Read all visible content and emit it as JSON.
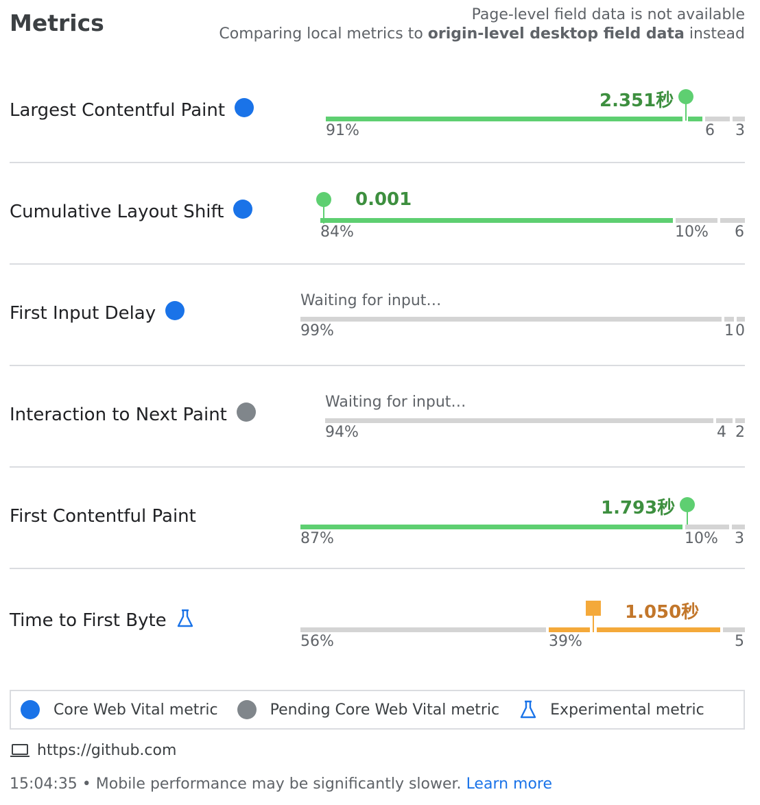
{
  "header": {
    "title": "Metrics",
    "note_line1": "Page-level field data is not available",
    "note_line2_prefix": "Comparing local metrics to ",
    "note_line2_bold": "origin-level desktop field data",
    "note_line2_suffix": " instead"
  },
  "metrics": [
    {
      "name": "Largest Contentful Paint",
      "kind": "core",
      "value": "2.351秒",
      "status": "good",
      "distribution": {
        "good": "91%",
        "ni": "6",
        "poor": "3"
      }
    },
    {
      "name": "Cumulative Layout Shift",
      "kind": "core",
      "value": "0.001",
      "status": "good",
      "distribution": {
        "good": "84%",
        "ni": "10%",
        "poor": "6"
      }
    },
    {
      "name": "First Input Delay",
      "kind": "core",
      "value": "Waiting for input…",
      "status": "pending",
      "distribution": {
        "good": "99%",
        "ni": "1",
        "poor": "0"
      }
    },
    {
      "name": "Interaction to Next Paint",
      "kind": "pending",
      "value": "Waiting for input…",
      "status": "pending",
      "distribution": {
        "good": "94%",
        "ni": "4",
        "poor": "2"
      }
    },
    {
      "name": "First Contentful Paint",
      "kind": "none",
      "value": "1.793秒",
      "status": "good",
      "distribution": {
        "good": "87%",
        "ni": "10%",
        "poor": "3"
      }
    },
    {
      "name": "Time to First Byte",
      "kind": "experimental",
      "value": "1.050秒",
      "status": "needs-improvement",
      "distribution": {
        "good": "56%",
        "ni": "39%",
        "poor": "5"
      }
    }
  ],
  "legend": {
    "core": "Core Web Vital metric",
    "pending": "Pending Core Web Vital metric",
    "experimental": "Experimental metric"
  },
  "url": "https://github.com",
  "footer": {
    "time": "15:04:35",
    "separator": " • ",
    "message": "Mobile performance may be significantly slower.",
    "link": "Learn more"
  },
  "colors": {
    "good": "#5ecf71",
    "needs_improvement": "#f4a93a",
    "neutral": "#d4d4d4",
    "core_dot": "#1a73e8",
    "pending_dot": "#80868b",
    "link": "#1a73e8"
  }
}
